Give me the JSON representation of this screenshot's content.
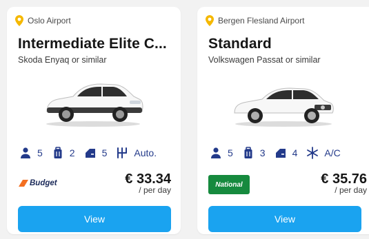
{
  "colors": {
    "accent": "#1aa3f0",
    "pin": "#f5b800",
    "spec": "#233a8a",
    "national": "#168a3e"
  },
  "cards": [
    {
      "location": "Oslo Airport",
      "title": "Intermediate Elite C...",
      "subtitle": "Skoda Enyaq or similar",
      "specs": {
        "seats": "5",
        "bags": "2",
        "doors": "5",
        "transmission": "Auto."
      },
      "supplier_logo": "Budget",
      "price": "€ 33.34",
      "per": "/ per day",
      "button": "View"
    },
    {
      "location": "Bergen Flesland Airport",
      "title": "Standard",
      "subtitle": "Volkswagen Passat or similar",
      "specs": {
        "seats": "5",
        "bags": "3",
        "doors": "4",
        "ac": "A/C"
      },
      "supplier_logo": "National",
      "price": "€ 35.76",
      "per": "/ per day",
      "button": "View"
    }
  ]
}
